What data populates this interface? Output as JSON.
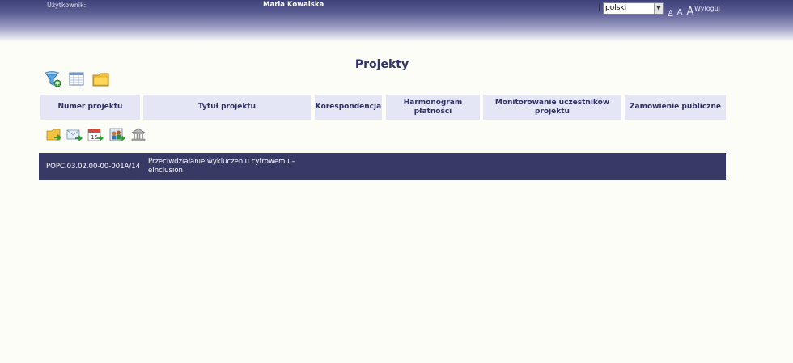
{
  "header": {
    "user_label": "Użytkownik:",
    "user_name": "Maria Kowalska",
    "language": "polski",
    "font_small": "A",
    "font_medium": "A",
    "font_large": "A",
    "logout": "Wyloguj"
  },
  "page": {
    "title": "Projekty"
  },
  "toolbar_icons": [
    "filter-icon",
    "table-view-icon",
    "folder-icon"
  ],
  "columns": [
    "Numer projektu",
    "Tytuł projektu",
    "Korespondencja",
    "Harmonogram płatności",
    "Monitorowanie uczestników projektu",
    "Zamowienie publiczne"
  ],
  "action_icons": [
    "folder-arrow-icon",
    "mail-arrow-icon",
    "calendar-15-icon",
    "participants-icon",
    "institution-icon"
  ],
  "projects": [
    {
      "number": "POPC.03.02.00-00-001A/14",
      "title": "Przeciwdziałanie wykluczeniu cyfrowemu – eInclusion"
    }
  ]
}
